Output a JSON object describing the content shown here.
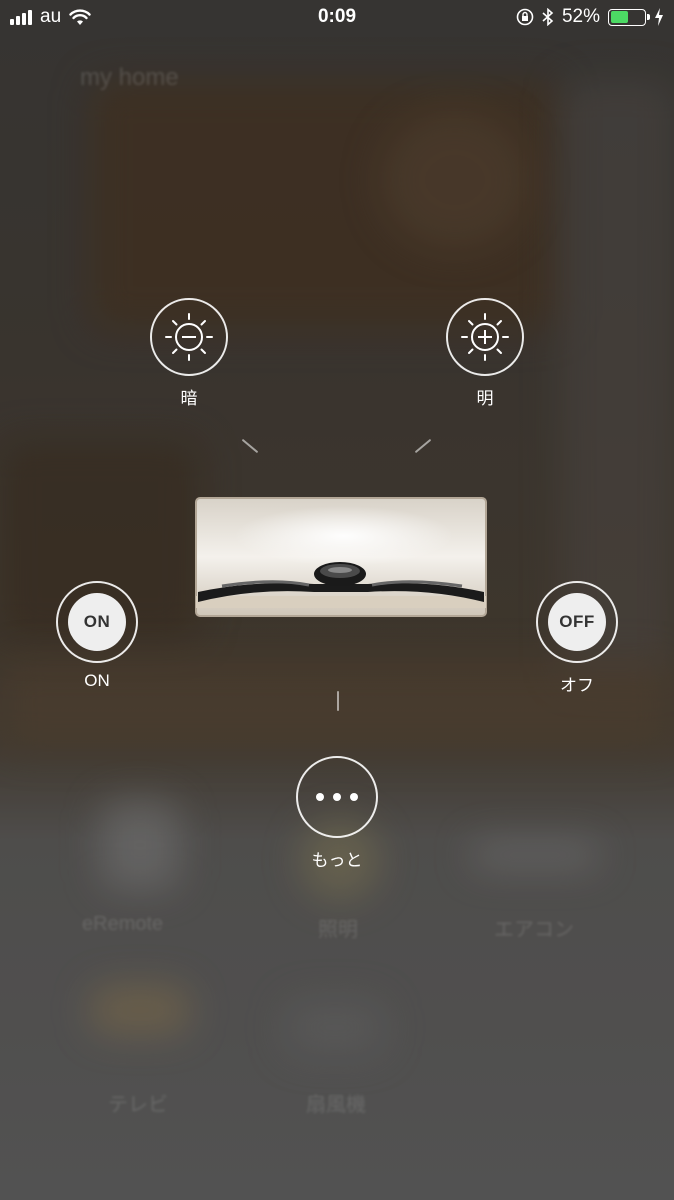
{
  "status_bar": {
    "carrier": "au",
    "time": "0:09",
    "battery_percent": "52%",
    "battery_level": 0.52,
    "battery_color": "#4cd964",
    "icons": [
      "signal-icon",
      "wifi-icon",
      "rotation-lock-icon",
      "bluetooth-icon",
      "battery-icon",
      "charging-icon"
    ]
  },
  "background": {
    "home_title": "my home",
    "tiles": [
      "eRemote",
      "照明",
      "エアコン",
      "テレビ",
      "扇風機"
    ]
  },
  "controls": {
    "dim": {
      "label": "暗",
      "icon": "brightness-minus-icon"
    },
    "bright": {
      "label": "明",
      "icon": "brightness-plus-icon"
    },
    "on": {
      "label": "ON",
      "badge": "ON"
    },
    "off": {
      "label": "オフ",
      "badge": "OFF"
    },
    "more": {
      "label": "もっと",
      "icon": "more-dots-icon"
    }
  },
  "device": {
    "icon": "air-conditioner-icon"
  }
}
